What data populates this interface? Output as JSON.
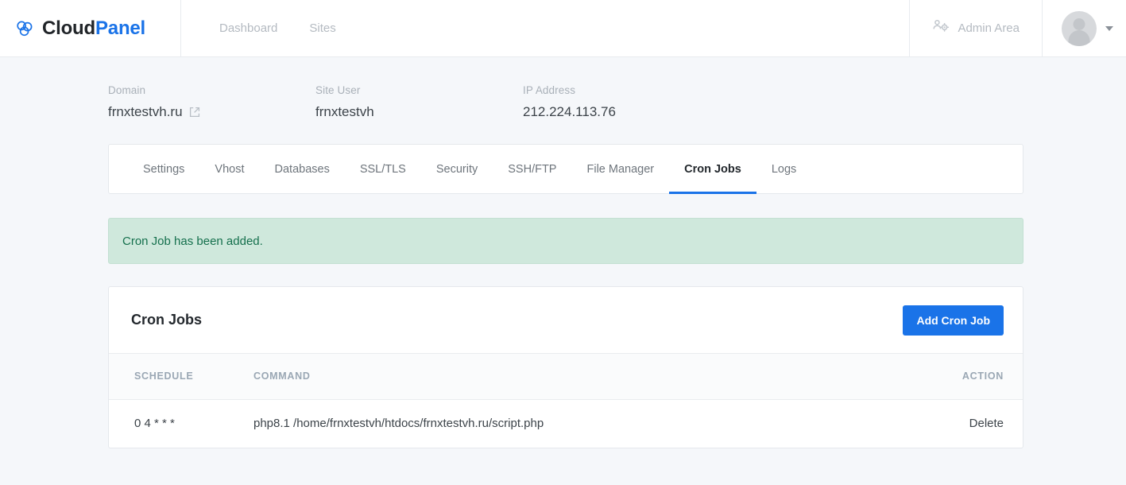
{
  "header": {
    "brand": {
      "first": "Cloud",
      "second": "Panel",
      "logo_icon": "cloud-logo-icon"
    },
    "nav": [
      {
        "label": "Dashboard",
        "name": "nav-dashboard"
      },
      {
        "label": "Sites",
        "name": "nav-sites"
      }
    ],
    "admin": {
      "label": "Admin Area",
      "icon": "users-gear-icon"
    },
    "user": {
      "avatar_icon": "user-avatar-icon",
      "caret_icon": "chevron-down-icon"
    }
  },
  "site_info": [
    {
      "label": "Domain",
      "value": "frnxtestvh.ru",
      "has_external_link": true,
      "icon": "external-link-icon"
    },
    {
      "label": "Site User",
      "value": "frnxtestvh",
      "has_external_link": false
    },
    {
      "label": "IP Address",
      "value": "212.224.113.76",
      "has_external_link": false
    }
  ],
  "tabs": [
    {
      "label": "Settings",
      "active": false
    },
    {
      "label": "Vhost",
      "active": false
    },
    {
      "label": "Databases",
      "active": false
    },
    {
      "label": "SSL/TLS",
      "active": false
    },
    {
      "label": "Security",
      "active": false
    },
    {
      "label": "SSH/FTP",
      "active": false
    },
    {
      "label": "File Manager",
      "active": false
    },
    {
      "label": "Cron Jobs",
      "active": true
    },
    {
      "label": "Logs",
      "active": false
    }
  ],
  "alert": {
    "message": "Cron Job has been added.",
    "type": "success"
  },
  "cron_card": {
    "title": "Cron Jobs",
    "add_button_label": "Add Cron Job",
    "columns": [
      "Schedule",
      "Command",
      "Action"
    ],
    "rows": [
      {
        "schedule": "0 4 * * *",
        "command": "php8.1 /home/frnxtestvh/htdocs/frnxtestvh.ru/script.php",
        "action_label": "Delete"
      }
    ]
  },
  "colors": {
    "brand_blue": "#1a73e8",
    "page_bg": "#f5f7fa",
    "alert_bg": "#cfe8dc",
    "alert_text": "#15704d",
    "muted_text": "#b4bac1"
  }
}
